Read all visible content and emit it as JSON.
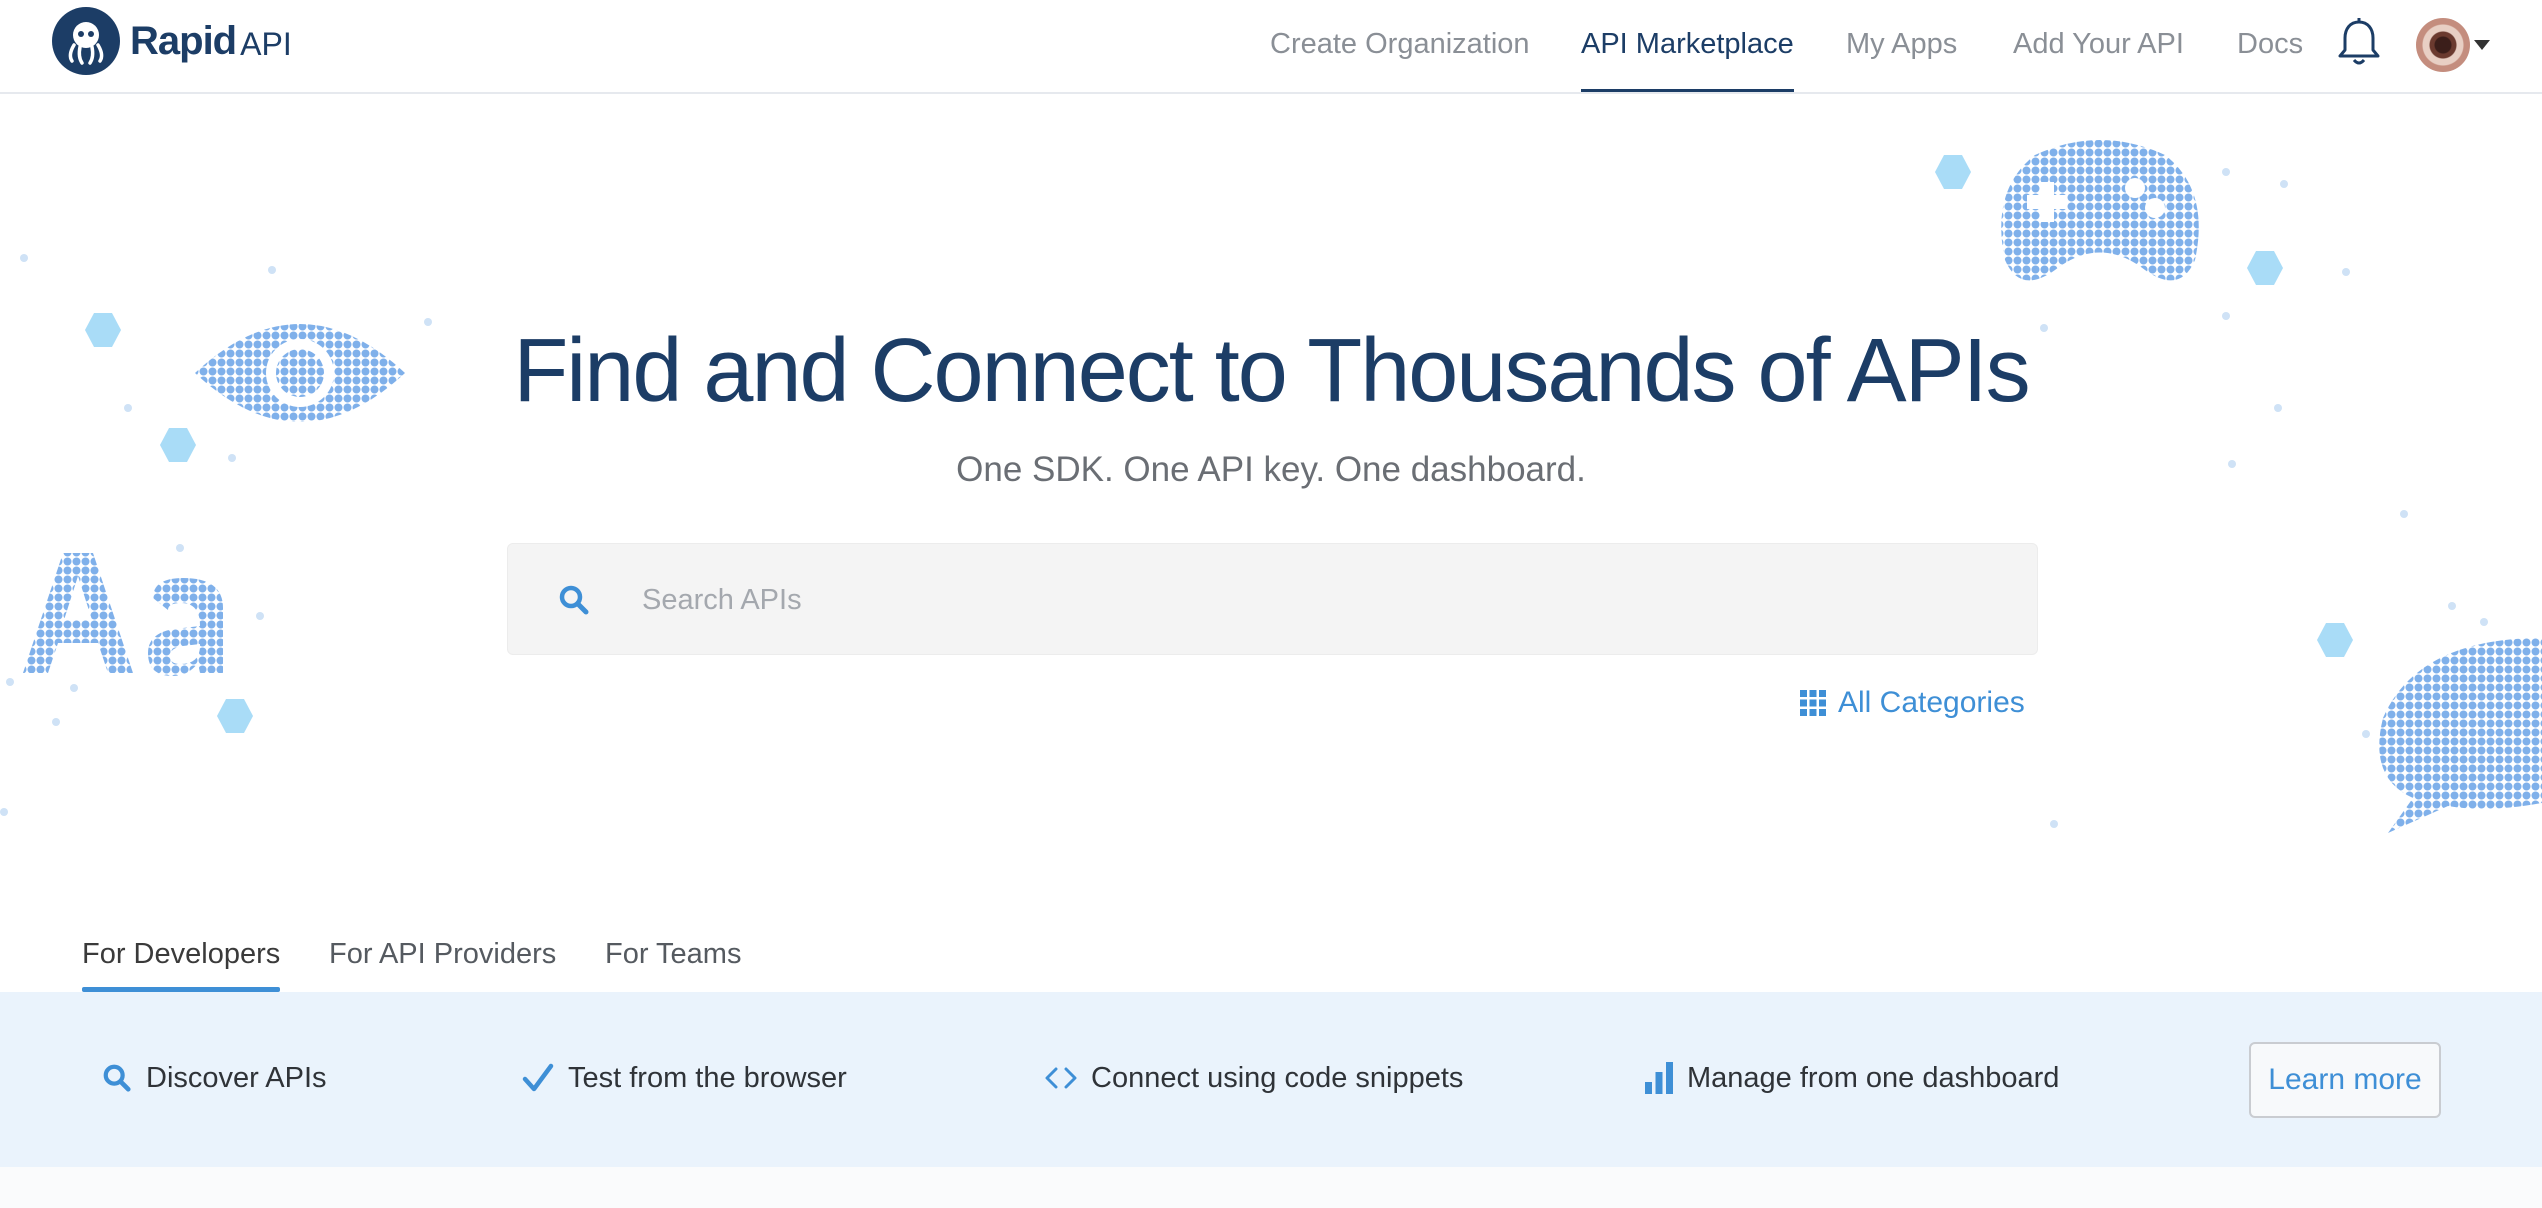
{
  "brand": {
    "name": "Rapid",
    "suffix": "API"
  },
  "nav": {
    "links": [
      {
        "label": "Create Organization"
      },
      {
        "label": "API Marketplace",
        "active": true
      },
      {
        "label": "My Apps"
      },
      {
        "label": "Add Your API"
      },
      {
        "label": "Docs"
      }
    ],
    "icons": [
      "bell-icon",
      "avatar",
      "caret-down-icon"
    ]
  },
  "hero": {
    "title": "Find and Connect to Thousands of APIs",
    "subtitle": "One SDK. One API key. One dashboard."
  },
  "search": {
    "placeholder": "Search APIs",
    "value": ""
  },
  "categories": {
    "label": "All Categories"
  },
  "tabs": [
    {
      "label": "For Developers",
      "active": true
    },
    {
      "label": "For API Providers"
    },
    {
      "label": "For Teams"
    }
  ],
  "features": [
    {
      "label": "Discover APIs",
      "icon": "search-icon"
    },
    {
      "label": "Test from the browser",
      "icon": "check-icon"
    },
    {
      "label": "Connect using code snippets",
      "icon": "code-icon"
    },
    {
      "label": "Manage from one dashboard",
      "icon": "bar-chart-icon"
    }
  ],
  "cta": {
    "label": "Learn more"
  },
  "colors": {
    "brand_navy": "#1c3d66",
    "accent_blue": "#3e8fd6",
    "band_bg": "#eaf3fc",
    "hex_light": "#a9dcf7",
    "dot_art": "#7fb0ea"
  }
}
